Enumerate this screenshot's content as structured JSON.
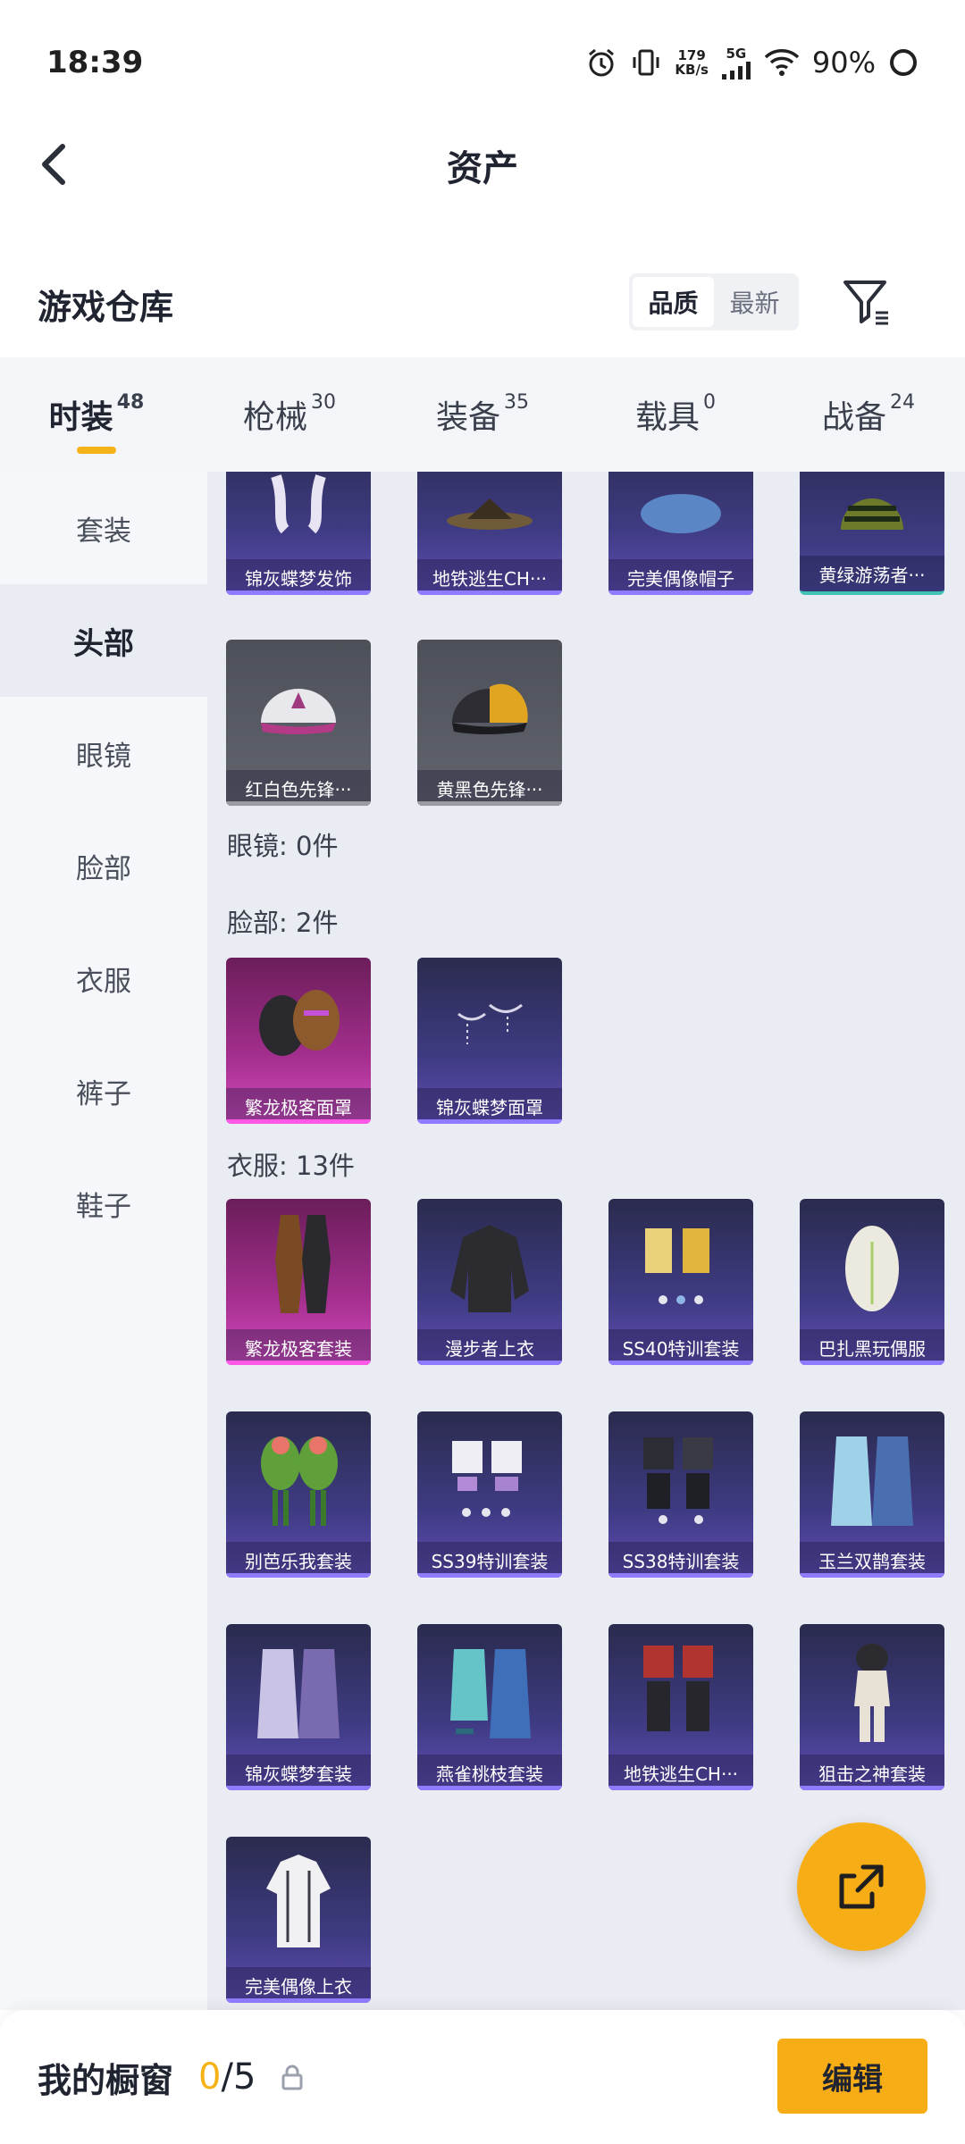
{
  "status": {
    "time": "18:39",
    "speed_value": "179",
    "speed_unit": "KB/s",
    "network": "5G",
    "battery": "90%"
  },
  "header": {
    "title": "资产"
  },
  "warehouse": {
    "title": "游戏仓库",
    "sort_options": [
      "品质",
      "最新"
    ],
    "sort_selected": "品质"
  },
  "tabs": [
    {
      "label": "时装",
      "count": "48",
      "active": true
    },
    {
      "label": "枪械",
      "count": "30"
    },
    {
      "label": "装备",
      "count": "35"
    },
    {
      "label": "载具",
      "count": "0"
    },
    {
      "label": "战备",
      "count": "24"
    }
  ],
  "sidenav": [
    {
      "label": "套装"
    },
    {
      "label": "头部",
      "active": true
    },
    {
      "label": "眼镜"
    },
    {
      "label": "脸部"
    },
    {
      "label": "衣服"
    },
    {
      "label": "裤子"
    },
    {
      "label": "鞋子"
    }
  ],
  "sections": {
    "glasses": "眼镜: 0件",
    "face": "脸部: 2件",
    "clothes": "衣服: 13件"
  },
  "items": {
    "head_row1": [
      "锦灰蝶梦发饰",
      "地铁逃生CH···",
      "完美偶像帽子",
      "黄绿游荡者···"
    ],
    "head_row2": [
      "红白色先锋···",
      "黄黑色先锋···"
    ],
    "face": [
      "繁龙极客面罩",
      "锦灰蝶梦面罩"
    ],
    "clothes_row1": [
      "繁龙极客套装",
      "漫步者上衣",
      "SS40特训套装",
      "巴扎黑玩偶服"
    ],
    "clothes_row2": [
      "别芭乐我套装",
      "SS39特训套装",
      "SS38特训套装",
      "玉兰双鹊套装"
    ],
    "clothes_row3": [
      "锦灰蝶梦套装",
      "燕雀桃枝套装",
      "地铁逃生CH···",
      "狙击之神套装"
    ],
    "clothes_row4": [
      "完美偶像上衣"
    ]
  },
  "showcase": {
    "title": "我的橱窗",
    "current": "0",
    "total": "/5",
    "edit_label": "编辑"
  },
  "colors": {
    "accent": "#f7ad16",
    "card_purple": "#3f3b83",
    "card_pink": "#a42f8e"
  }
}
